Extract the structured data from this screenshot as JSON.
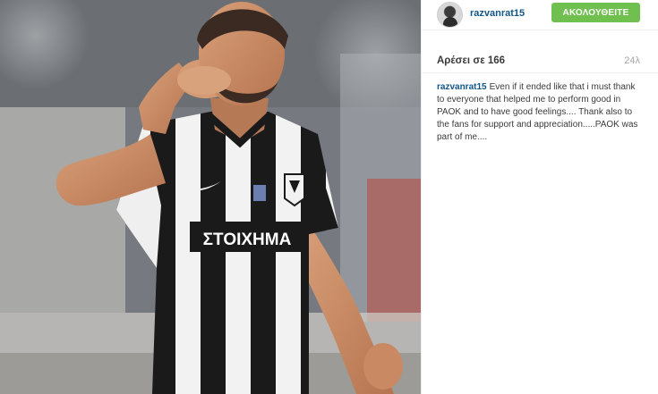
{
  "post": {
    "username": "razvanrat15",
    "follow_label": "ΑΚΟΛΟΥΘΕΙΤΕ",
    "likes_text": "Αρέσει σε 166",
    "timestamp": "24λ",
    "caption_user": "razvanrat15",
    "caption_text": "Even if it ended like that i must thank to everyone that helped me to perform good in PAOK and to have good feelings.... Thank also to the fans for support and appreciation.....PAOK was part of me....",
    "jersey_sponsor": "ΣΤΟΙΧΗΜΑ"
  },
  "colors": {
    "follow_button": "#70c050",
    "username": "#125688",
    "timestamp": "#a5a5a5"
  },
  "icons": [
    "avatar",
    "nike-swoosh-icon",
    "paok-crest-icon"
  ]
}
